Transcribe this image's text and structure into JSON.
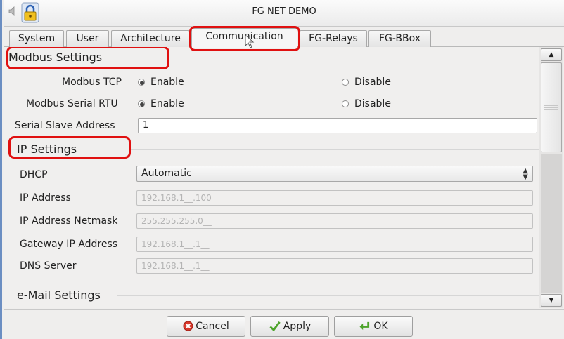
{
  "window": {
    "title": "FG NET DEMO"
  },
  "tabs": [
    {
      "label": "System"
    },
    {
      "label": "User"
    },
    {
      "label": "Architecture"
    },
    {
      "label": "Communication",
      "active": true
    },
    {
      "label": "FG-Relays"
    },
    {
      "label": "FG-BBox"
    }
  ],
  "modbus": {
    "header": "Modbus Settings",
    "tcp_label": "Modbus TCP",
    "rtu_label": "Modbus Serial RTU",
    "enable_label": "Enable",
    "disable_label": "Disable",
    "tcp_value": "Enable",
    "rtu_value": "Enable",
    "slave_label": "Serial Slave Address",
    "slave_value": "1"
  },
  "ip": {
    "header": "IP Settings",
    "dhcp_label": "DHCP",
    "dhcp_value": "Automatic",
    "ip_label": "IP Address",
    "ip_value": "192.168.1__.100",
    "netmask_label": "IP Address Netmask",
    "netmask_value": "255.255.255.0__",
    "gateway_label": "Gateway IP Address",
    "gateway_value": "192.168.1__.1__",
    "dns_label": "DNS Server",
    "dns_value": "192.168.1__.1__"
  },
  "email": {
    "header": "e-Mail Settings"
  },
  "buttons": {
    "cancel": "Cancel",
    "apply": "Apply",
    "ok": "OK"
  },
  "colors": {
    "highlight": "#e01010",
    "window_border": "#6b8ec2"
  }
}
